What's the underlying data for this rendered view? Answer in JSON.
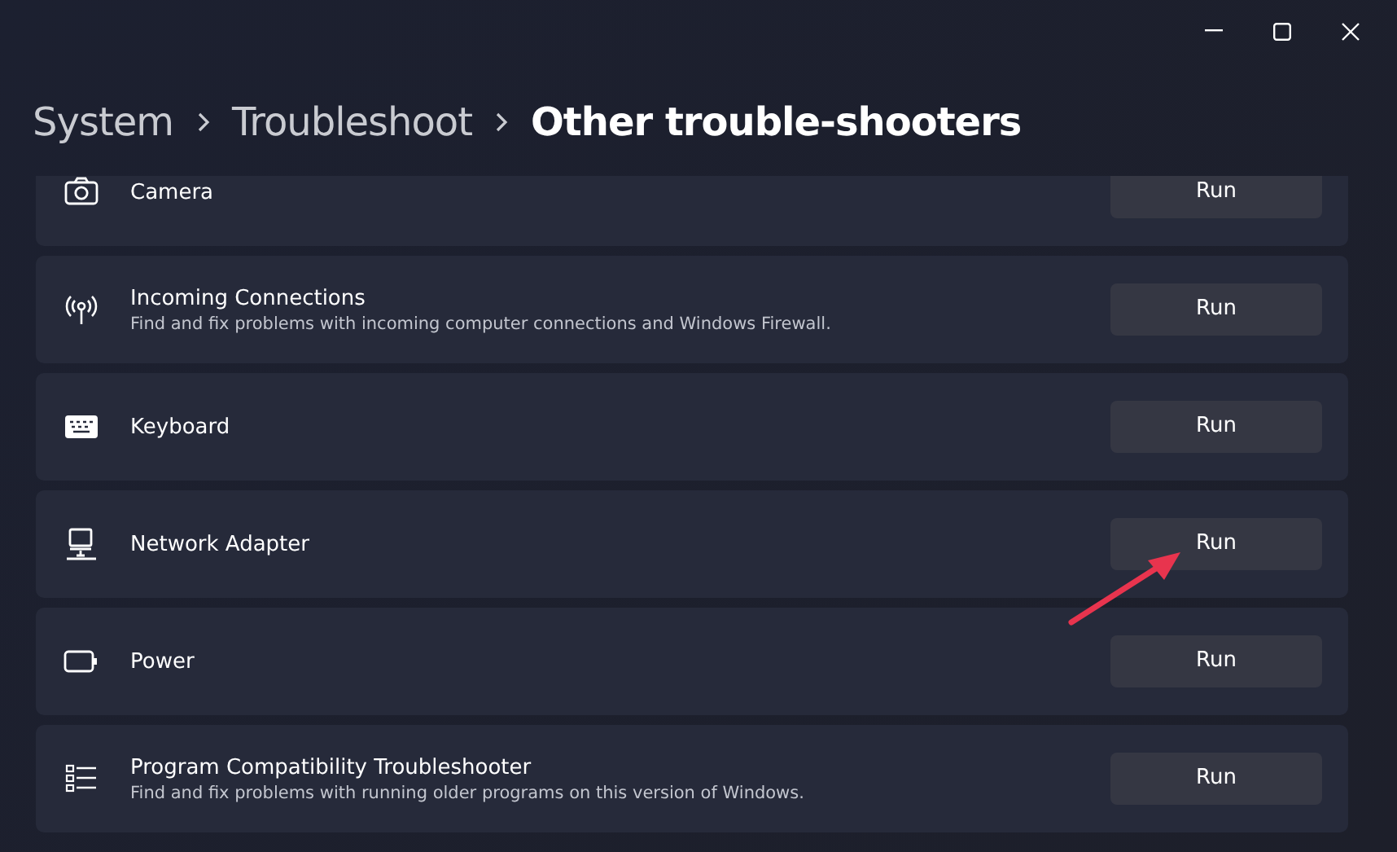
{
  "breadcrumb": [
    {
      "label": "System",
      "current": false
    },
    {
      "label": "Troubleshoot",
      "current": false
    },
    {
      "label": "Other trouble-shooters",
      "current": true
    }
  ],
  "troubleshooters": [
    {
      "title": "Camera",
      "button": "Run"
    },
    {
      "title": "Incoming Connections",
      "description": "Find and fix problems with incoming computer connections and Windows Firewall.",
      "button": "Run"
    },
    {
      "title": "Keyboard",
      "button": "Run"
    },
    {
      "title": "Network Adapter",
      "button": "Run"
    },
    {
      "title": "Power",
      "button": "Run"
    },
    {
      "title": "Program Compatibility Troubleshooter",
      "description": "Find and fix problems with running older programs on this version of Windows.",
      "button": "Run"
    }
  ]
}
